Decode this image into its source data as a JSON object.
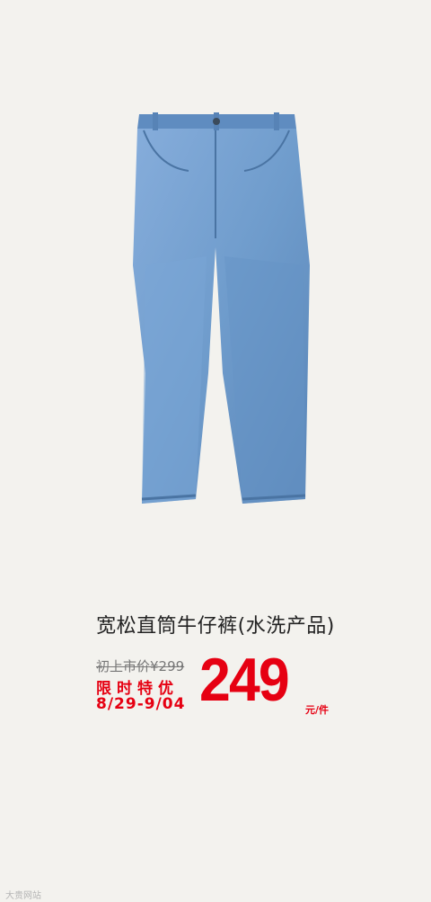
{
  "product": {
    "title": "宽松直筒牛仔裤(水洗产品)",
    "original_price": "初上市价¥299",
    "promo_label": "限时特优",
    "promo_dates": "8/29-9/04",
    "price": "249",
    "unit": "元/件",
    "image_icon": "jeans-image"
  },
  "watermark": "大贵网站",
  "colors": {
    "background": "#f3f2ee",
    "accent_red": "#e60012",
    "denim": "#6f9ccc"
  }
}
